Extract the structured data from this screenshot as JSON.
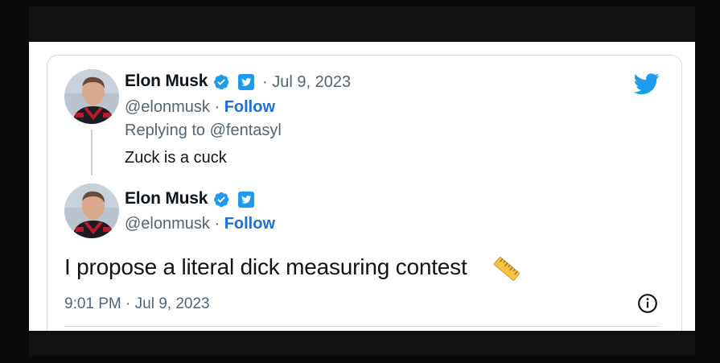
{
  "reply_tweet": {
    "author_name": "Elon Musk",
    "date": "· Jul 9, 2023",
    "handle": "@elonmusk",
    "handle_sep": " · ",
    "follow_label": "Follow",
    "replying_to": "Replying to @fentasyl",
    "text": "Zuck is a cuck"
  },
  "main_tweet": {
    "author_name": "Elon Musk",
    "handle": "@elonmusk",
    "handle_sep": " · ",
    "follow_label": "Follow",
    "text": "I propose a literal dick measuring contest",
    "emoji_icon": "ruler-icon",
    "timestamp": "9:01 PM · Jul 9, 2023"
  },
  "colors": {
    "verified_blue": "#1d9bf0",
    "follow_blue": "#1d6ed8",
    "secondary_text": "#536471",
    "primary_text": "#0f1419"
  },
  "icons": {
    "logo": "twitter-bird-icon",
    "verified": "verified-badge-icon",
    "business": "twitter-square-icon",
    "info": "info-icon"
  }
}
